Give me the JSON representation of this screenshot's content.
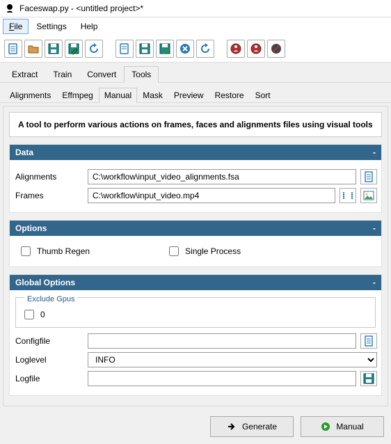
{
  "title": "Faceswap.py - <untitled project>*",
  "menu": {
    "file": "File",
    "settings": "Settings",
    "help": "Help"
  },
  "tabs": {
    "extract": "Extract",
    "train": "Train",
    "convert": "Convert",
    "tools": "Tools"
  },
  "subtabs": {
    "alignments": "Alignments",
    "effmpeg": "Effmpeg",
    "manual": "Manual",
    "mask": "Mask",
    "preview": "Preview",
    "restore": "Restore",
    "sort": "Sort"
  },
  "description": "A tool to perform various actions on frames, faces and alignments files using visual tools",
  "sections": {
    "data": {
      "title": "Data",
      "alignments_label": "Alignments",
      "alignments_value": "C:\\workflow\\input_video_alignments.fsa",
      "frames_label": "Frames",
      "frames_value": "C:\\workflow\\input_video.mp4"
    },
    "options": {
      "title": "Options",
      "thumb_regen": "Thumb Regen",
      "single_process": "Single Process"
    },
    "global": {
      "title": "Global Options",
      "exclude_gpus_label": "Exclude Gpus",
      "gpu0": "0",
      "configfile_label": "Configfile",
      "configfile_value": "",
      "loglevel_label": "Loglevel",
      "loglevel_value": "INFO",
      "logfile_label": "Logfile",
      "logfile_value": ""
    }
  },
  "footer": {
    "generate": "Generate",
    "manual": "Manual"
  },
  "collapse": "-"
}
